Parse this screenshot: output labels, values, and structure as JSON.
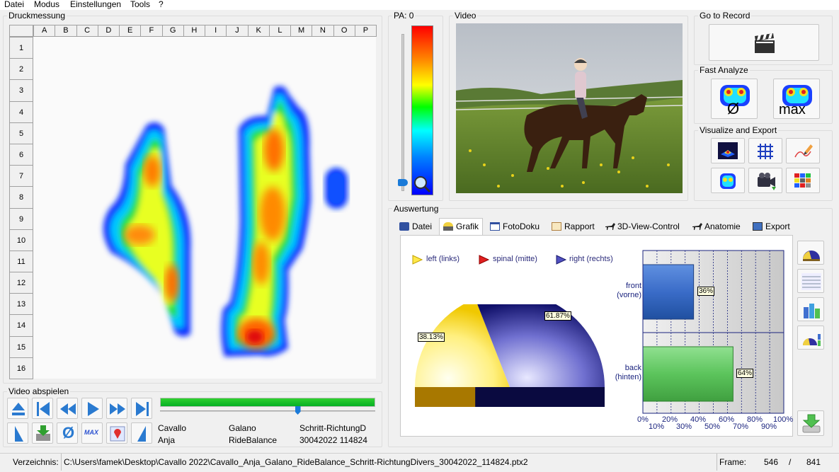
{
  "menu": [
    "Datei",
    "Modus",
    "Einstellungen",
    "Tools",
    "?"
  ],
  "druck": {
    "title": "Druckmessung",
    "columns": [
      "A",
      "B",
      "C",
      "D",
      "E",
      "F",
      "G",
      "H",
      "I",
      "J",
      "K",
      "L",
      "M",
      "N",
      "O",
      "P"
    ],
    "rows": [
      "1",
      "2",
      "3",
      "4",
      "5",
      "6",
      "7",
      "8",
      "9",
      "10",
      "11",
      "12",
      "13",
      "14",
      "15",
      "16"
    ]
  },
  "pa": {
    "label": "PA: 0"
  },
  "video": {
    "title": "Video"
  },
  "goto": {
    "title": "Go to Record"
  },
  "fast": {
    "title": "Fast Analyze",
    "avg_label": "Ø",
    "max_label": "max"
  },
  "visexp": {
    "title": "Visualize and Export"
  },
  "playback": {
    "title": "Video abspielen",
    "speed_label": "MAX",
    "info": [
      [
        "Cavallo",
        "Galano",
        "Schritt-RichtungD"
      ],
      [
        "Anja",
        "RideBalance",
        "30042022 114824"
      ]
    ]
  },
  "auswertung": {
    "title": "Auswertung",
    "tabs": [
      "Datei",
      "Grafik",
      "FotoDoku",
      "Rapport",
      "3D-View-Control",
      "Anatomie",
      "Export"
    ],
    "active_tab": "Grafik",
    "legend": [
      "left (links)",
      "spinal (mitte)",
      "right (rechts)"
    ],
    "bar_labels": [
      [
        "front",
        "(vorne)"
      ],
      [
        "back",
        "(hinten)"
      ]
    ],
    "x_ticks_top": [
      "0%",
      "20%",
      "40%",
      "60%",
      "80%",
      "100%"
    ],
    "x_ticks_bottom": [
      "10%",
      "30%",
      "50%",
      "70%",
      "90%"
    ]
  },
  "chart_data": [
    {
      "type": "pie",
      "title": "",
      "labels": [
        "left (links)",
        "spinal (mitte)",
        "right (rechts)"
      ],
      "values": [
        38.13,
        0,
        61.87
      ],
      "value_labels": [
        "38.13%",
        "",
        "61.87%"
      ],
      "colors": [
        "#ffe84a",
        "#e02020",
        "#1a1a8a"
      ],
      "shape": "half-pie"
    },
    {
      "type": "bar",
      "orientation": "horizontal",
      "categories": [
        "front (vorne)",
        "back (hinten)"
      ],
      "values": [
        36,
        64
      ],
      "value_labels": [
        "36%",
        "64%"
      ],
      "colors": [
        "#3a6cc8",
        "#5cc45c"
      ],
      "xlim": [
        0,
        100
      ],
      "grid": true
    }
  ],
  "status": {
    "verzeichnis_label": "Verzeichnis:",
    "path": "C:\\Users\\famek\\Desktop\\Cavallo 2022\\Cavallo_Anja_Galano_RideBalance_Schritt-RichtungDivers_30042022_114824.ptx2",
    "frame_label": "Frame:",
    "frame": "546",
    "sep": "/",
    "total": "841"
  },
  "progress": {
    "fraction": 1.0
  },
  "slider": {
    "position": 0.64
  }
}
